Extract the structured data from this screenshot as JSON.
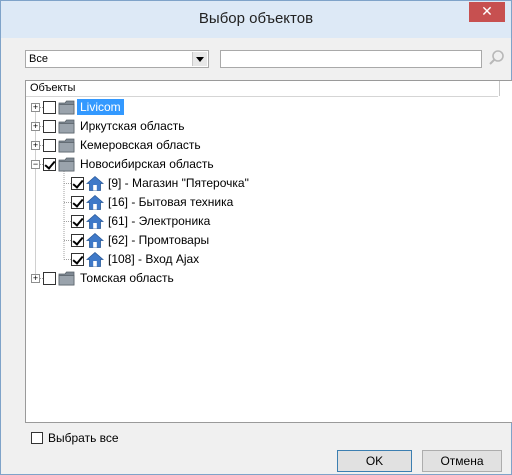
{
  "window": {
    "title": "Выбор объектов",
    "close_glyph": "✕",
    "accent_color": "#3399ff",
    "close_color": "#c75050"
  },
  "filter": {
    "selected": "Все",
    "search_value": "",
    "search_icon": "search-icon"
  },
  "tree": {
    "column_header": "Объекты",
    "rows": [
      {
        "label": "Livicom",
        "level": 0,
        "expander": "+",
        "checked": false,
        "icon": "folder-icon",
        "selected": true
      },
      {
        "label": "Иркутская область",
        "level": 0,
        "expander": "+",
        "checked": false,
        "icon": "folder-icon",
        "selected": false
      },
      {
        "label": "Кемеровская область",
        "level": 0,
        "expander": "+",
        "checked": false,
        "icon": "folder-icon",
        "selected": false
      },
      {
        "label": "Новосибирская область",
        "level": 0,
        "expander": "−",
        "checked": true,
        "icon": "folder-icon",
        "selected": false
      },
      {
        "label": "[9] - Магазин \"Пятерочка\"",
        "level": 1,
        "checked": true,
        "icon": "house-icon",
        "selected": false
      },
      {
        "label": "[16] - Бытовая техника",
        "level": 1,
        "checked": true,
        "icon": "house-icon",
        "selected": false
      },
      {
        "label": "[61] - Электроника",
        "level": 1,
        "checked": true,
        "icon": "house-icon",
        "selected": false
      },
      {
        "label": "[62] - Промтовары",
        "level": 1,
        "checked": true,
        "icon": "house-icon",
        "selected": false
      },
      {
        "label": "[108] - Вход Ajax",
        "level": 1,
        "checked": true,
        "icon": "house-icon",
        "selected": false
      },
      {
        "label": "Томская область",
        "level": 0,
        "expander": "+",
        "checked": false,
        "icon": "folder-icon",
        "selected": false
      }
    ]
  },
  "footer": {
    "select_all_label": "Выбрать все",
    "select_all_checked": false,
    "ok_label": "OK",
    "cancel_label": "Отмена"
  }
}
